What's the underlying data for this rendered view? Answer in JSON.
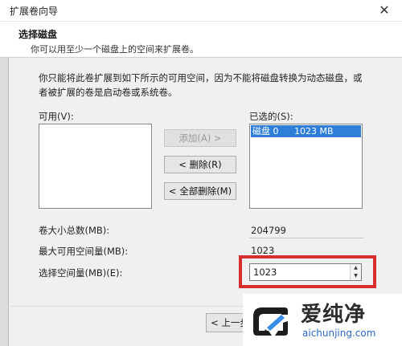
{
  "window": {
    "title": "扩展卷向导",
    "close_glyph": "✕"
  },
  "header": {
    "title": "选择磁盘",
    "subtitle": "你可以用至少一个磁盘上的空间来扩展卷。"
  },
  "description": "你只能将此卷扩展到如下所示的可用空间，因为不能将磁盘转换为动态磁盘，或者被扩展的卷是启动卷或系统卷。",
  "available": {
    "label": "可用(V):",
    "items": []
  },
  "selected": {
    "label": "已选的(S):",
    "items": [
      {
        "disk": "磁盘 0",
        "size": "1023 MB"
      }
    ]
  },
  "buttons": {
    "add": "添加(A) >",
    "remove": "< 删除(R)",
    "remove_all": "< 全部删除(M)",
    "back": "< 上一步"
  },
  "fields": {
    "total_label": "卷大小总数(MB):",
    "total_value": "204799",
    "max_label": "最大可用空间量(MB):",
    "max_value": "1023",
    "select_label": "选择空间量(MB)(E):",
    "select_value": "1023"
  },
  "watermark": {
    "name": "爱纯净",
    "url": "aichunjing.com"
  },
  "colors": {
    "selection": "#2f7fd8",
    "highlight_box": "#d72f2f",
    "watermark_url": "#2a66c5"
  }
}
